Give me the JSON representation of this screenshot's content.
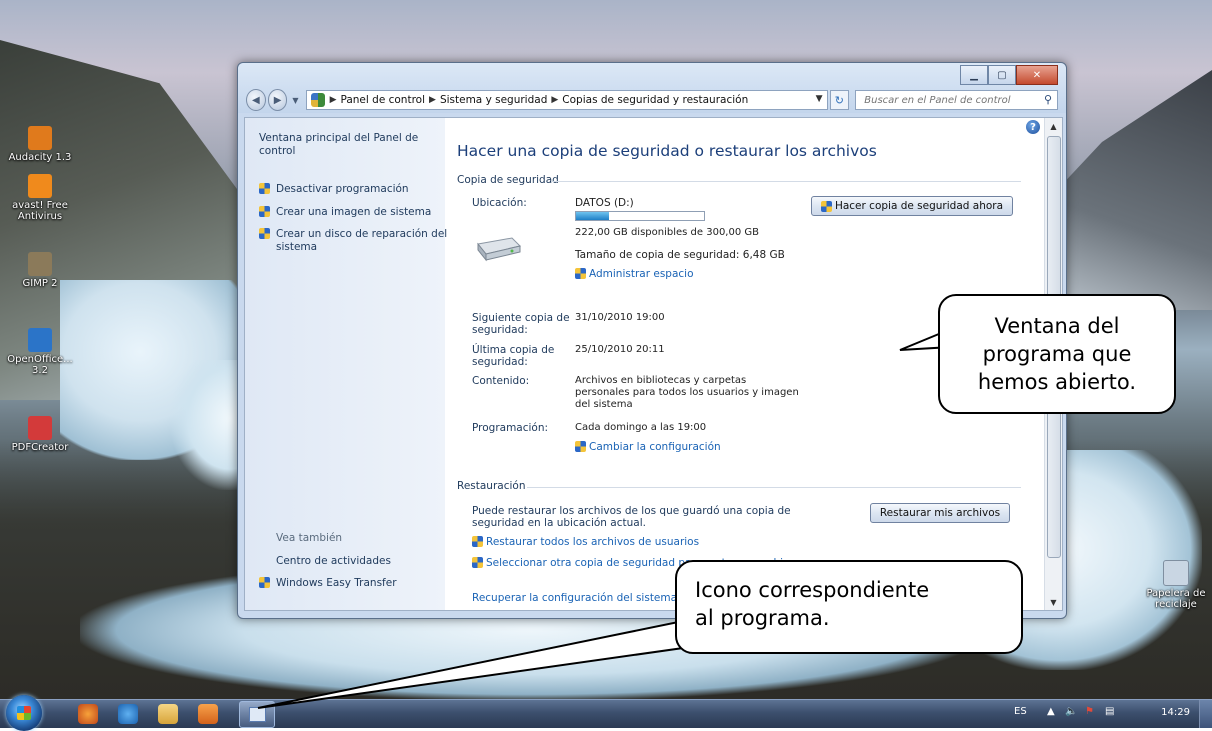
{
  "desktop": {
    "icons": [
      {
        "label": "Audacity 1.3",
        "icon": "audacity-icon",
        "color": "#e07a1c"
      },
      {
        "label": "avast! Free\nAntivirus",
        "icon": "avast-icon",
        "color": "#f08a1c"
      },
      {
        "label": "GIMP 2",
        "icon": "gimp-icon",
        "color": "#8b7a5a"
      },
      {
        "label": "OpenOffice...\n3.2",
        "icon": "openoffice-icon",
        "color": "#2b74c8"
      },
      {
        "label": "PDFCreator",
        "icon": "pdfcreator-icon",
        "color": "#d33a3a"
      },
      {
        "label": "Papelera de\nreciclaje",
        "icon": "recycle-bin-icon",
        "color": "#c9d6e3"
      }
    ]
  },
  "window": {
    "breadcrumb": [
      "Panel de control",
      "Sistema y seguridad",
      "Copias de seguridad y restauración"
    ],
    "search_placeholder": "Buscar en el Panel de control",
    "left_pane": {
      "home_link": "Ventana principal del Panel de control",
      "tasks": [
        "Desactivar programación",
        "Crear una imagen de sistema",
        "Crear un disco de reparación del sistema"
      ],
      "see_also_title": "Vea también",
      "see_also": [
        "Centro de actividades",
        "Windows Easy Transfer"
      ]
    },
    "main": {
      "title": "Hacer una copia de seguridad o restaurar los archivos",
      "backup_section": "Copia de seguridad",
      "location_label": "Ubicación:",
      "location_value": "DATOS (D:)",
      "disk_used_fraction": 0.26,
      "free_space": "222,00 GB disponibles de 300,00 GB",
      "backup_size": "Tamaño de copia de seguridad: 6,48 GB",
      "manage_space": "Administrar espacio",
      "backup_now_button": "Hacer copia de seguridad ahora",
      "next_backup_label": "Siguiente copia de seguridad:",
      "next_backup_value": "31/10/2010 19:00",
      "last_backup_label": "Última copia de seguridad:",
      "last_backup_value": "25/10/2010 20:11",
      "contents_label": "Contenido:",
      "contents_value": "Archivos en bibliotecas y carpetas personales para todos los usuarios y imagen del sistema",
      "schedule_label": "Programación:",
      "schedule_value": "Cada domingo a las 19:00",
      "change_settings": "Cambiar la configuración",
      "restore_section": "Restauración",
      "restore_text": "Puede restaurar los archivos de los que guardó una copia de seguridad en la ubicación actual.",
      "restore_button": "Restaurar mis archivos",
      "restore_all_users": "Restaurar todos los archivos de usuarios",
      "select_other_backup": "Seleccionar otra copia de seguridad para restaurar archivos",
      "recover_settings": "Recuperar la configuración del sistema o el equipo"
    }
  },
  "taskbar": {
    "language": "ES",
    "clock": "14:29"
  },
  "callouts": {
    "window_note": "Ventana del\nprograma que\nhemos abierto.",
    "icon_note": "Icono  correspondiente\nal programa."
  },
  "colors": {
    "title_blue": "#1c3f7a",
    "link_blue": "#1a63b5",
    "taskbar": "#3c4f6d"
  }
}
